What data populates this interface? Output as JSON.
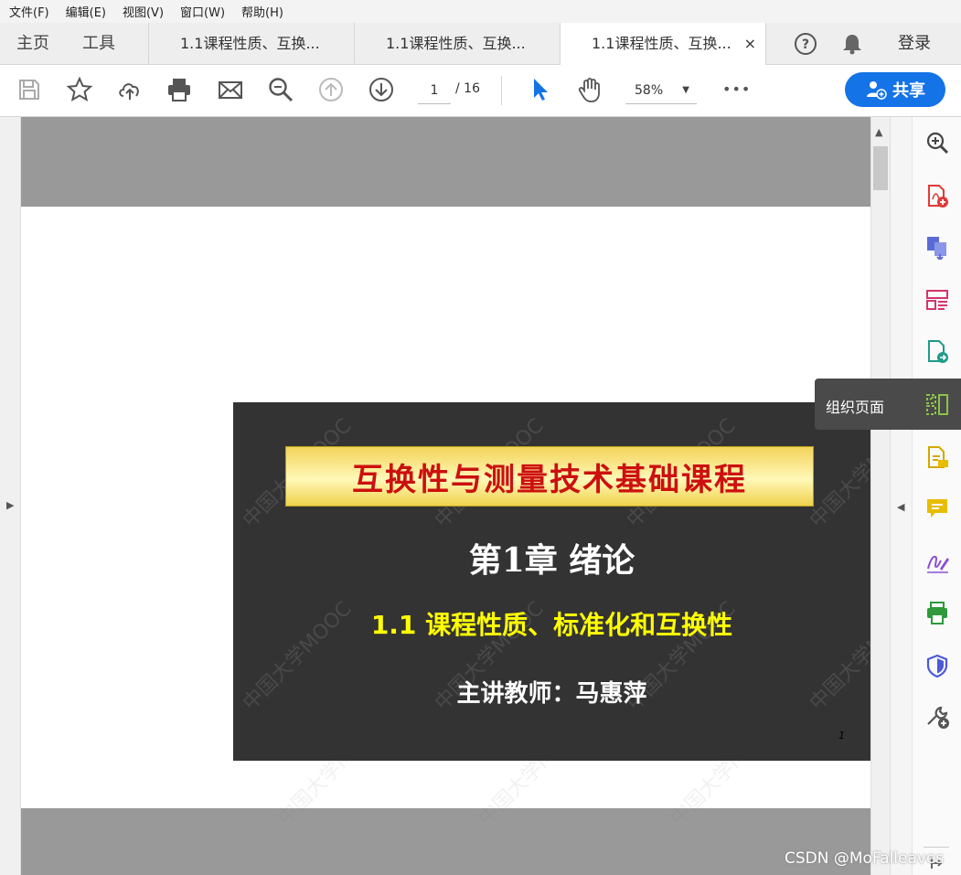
{
  "menu": [
    "文件(F)",
    "编辑(E)",
    "视图(V)",
    "窗口(W)",
    "帮助(H)"
  ],
  "tabs": {
    "home": "主页",
    "tools": "工具",
    "docs": [
      "1.1课程性质、互换...",
      "1.1课程性质、互换...",
      "1.1课程性质、互换..."
    ],
    "close": "×",
    "login": "登录"
  },
  "toolbar": {
    "page_current": "1",
    "page_total": "/ 16",
    "zoom": "58%",
    "more": "•••",
    "share": "共享"
  },
  "slide": {
    "banner": "互换性与测量技术基础课程",
    "chapter": "第1章 绪论",
    "section": "1.1 课程性质、标准化和互换性",
    "teacher": "主讲教师：马惠萍",
    "page_num": "1",
    "watermark": "中国大学MOOC"
  },
  "tooltip": "组织页面",
  "credit": "CSDN @MoFalleaves",
  "right_tools": [
    "zoom-icon",
    "create-pdf-icon",
    "export-pdf-icon",
    "edit-pdf-icon",
    "convert-pdf-icon",
    "organize-pages-icon",
    "comment-file-icon",
    "comment-icon",
    "fill-sign-icon",
    "print-production-icon",
    "protect-icon",
    "more-tools-icon"
  ],
  "colors": {
    "accent": "#1473e6",
    "slide_bg": "#333333",
    "slide_banner_text": "#cc1010",
    "slide_section": "#ffff00"
  }
}
